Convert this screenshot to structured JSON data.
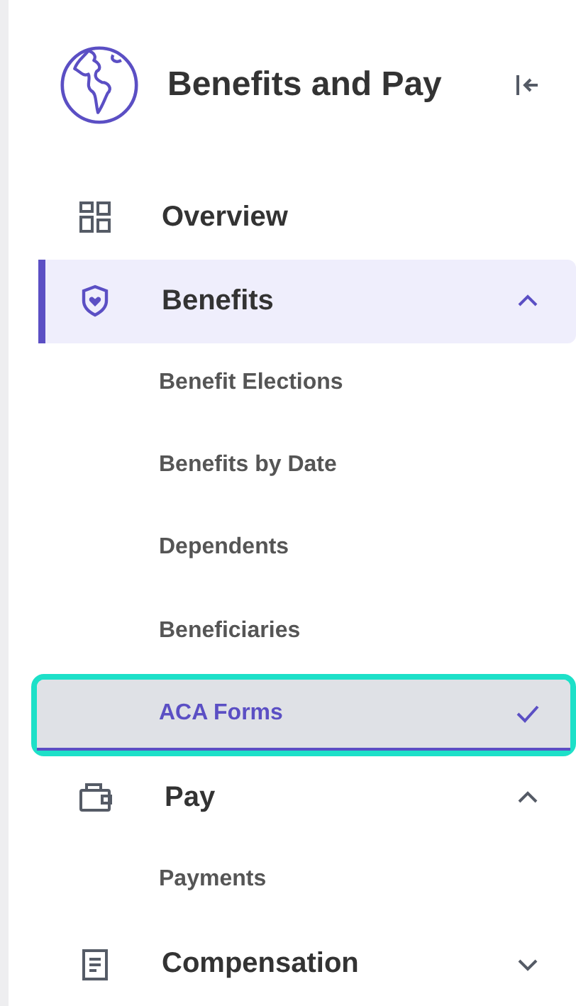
{
  "header": {
    "title": "Benefits and Pay"
  },
  "nav": [
    {
      "label": "Overview",
      "kind": "link",
      "selected": false
    },
    {
      "label": "Benefits",
      "kind": "group",
      "selected": true,
      "expanded": true,
      "children": [
        {
          "label": "Benefit Elections",
          "selected": false,
          "focused": false
        },
        {
          "label": "Benefits by Date",
          "selected": false,
          "focused": false
        },
        {
          "label": "Dependents",
          "selected": false,
          "focused": false
        },
        {
          "label": "Beneficiaries",
          "selected": false,
          "focused": false
        },
        {
          "label": "ACA Forms",
          "selected": true,
          "focused": true
        }
      ]
    },
    {
      "label": "Pay",
      "kind": "group",
      "selected": false,
      "expanded": true,
      "children": [
        {
          "label": "Payments",
          "selected": false,
          "focused": false
        }
      ]
    },
    {
      "label": "Compensation",
      "kind": "group",
      "selected": false,
      "expanded": false
    }
  ]
}
